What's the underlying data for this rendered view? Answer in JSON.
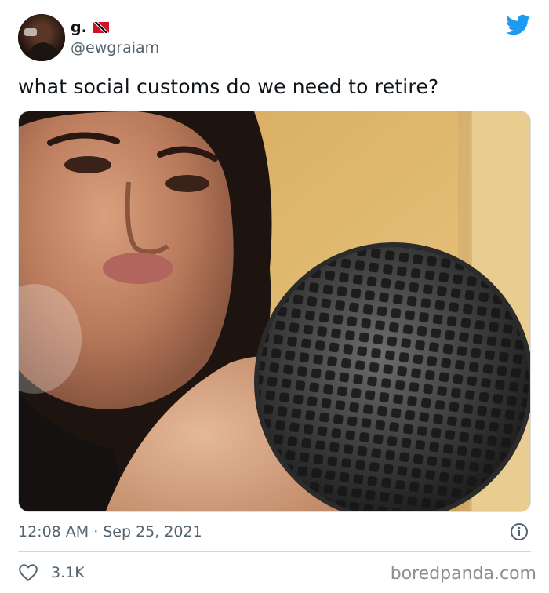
{
  "author": {
    "display_name": "g.",
    "handle": "@ewgraiam",
    "avatar_icon": "user-avatar",
    "flag_icon": "trinidad-tobago-flag-icon"
  },
  "tweet": {
    "text": "what social customs do we need to retire?",
    "time": "12:08 AM",
    "separator": "·",
    "date": "Sep 25, 2021",
    "likes": "3.1K"
  },
  "media": {
    "description_icon": "woman-holding-microphone-photo"
  },
  "brand": {
    "logo_icon": "twitter-bird-icon",
    "accent": "#1d9bf0"
  },
  "watermark": "boredpanda.com"
}
